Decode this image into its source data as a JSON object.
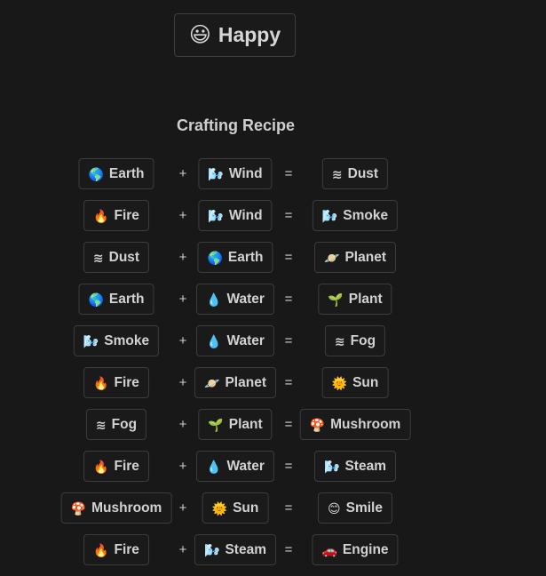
{
  "header": {
    "icon": "grinning-face-icon",
    "emoji": "😃",
    "label": "Happy"
  },
  "section_title": "Crafting Recipe",
  "operators": {
    "plus": "+",
    "equals": "="
  },
  "recipes": [
    {
      "a": {
        "emoji": "🌎",
        "icon": "earth-icon",
        "label": "Earth"
      },
      "b": {
        "emoji": "🌬️",
        "icon": "wind-icon",
        "label": "Wind"
      },
      "result": {
        "emoji": "≋",
        "icon": "dust-icon",
        "label": "Dust"
      }
    },
    {
      "a": {
        "emoji": "🔥",
        "icon": "fire-icon",
        "label": "Fire"
      },
      "b": {
        "emoji": "🌬️",
        "icon": "wind-icon",
        "label": "Wind"
      },
      "result": {
        "emoji": "🌬️",
        "icon": "smoke-icon",
        "label": "Smoke"
      }
    },
    {
      "a": {
        "emoji": "≋",
        "icon": "dust-icon",
        "label": "Dust"
      },
      "b": {
        "emoji": "🌎",
        "icon": "earth-icon",
        "label": "Earth"
      },
      "result": {
        "emoji": "🪐",
        "icon": "planet-icon",
        "label": "Planet"
      }
    },
    {
      "a": {
        "emoji": "🌎",
        "icon": "earth-icon",
        "label": "Earth"
      },
      "b": {
        "emoji": "💧",
        "icon": "water-icon",
        "label": "Water"
      },
      "result": {
        "emoji": "🌱",
        "icon": "plant-icon",
        "label": "Plant"
      }
    },
    {
      "a": {
        "emoji": "🌬️",
        "icon": "smoke-icon",
        "label": "Smoke"
      },
      "b": {
        "emoji": "💧",
        "icon": "water-icon",
        "label": "Water"
      },
      "result": {
        "emoji": "≋",
        "icon": "fog-icon",
        "label": "Fog"
      }
    },
    {
      "a": {
        "emoji": "🔥",
        "icon": "fire-icon",
        "label": "Fire"
      },
      "b": {
        "emoji": "🪐",
        "icon": "planet-icon",
        "label": "Planet"
      },
      "result": {
        "emoji": "🌞",
        "icon": "sun-icon",
        "label": "Sun"
      }
    },
    {
      "a": {
        "emoji": "≋",
        "icon": "fog-icon",
        "label": "Fog"
      },
      "b": {
        "emoji": "🌱",
        "icon": "plant-icon",
        "label": "Plant"
      },
      "result": {
        "emoji": "🍄",
        "icon": "mushroom-icon",
        "label": "Mushroom"
      }
    },
    {
      "a": {
        "emoji": "🔥",
        "icon": "fire-icon",
        "label": "Fire"
      },
      "b": {
        "emoji": "💧",
        "icon": "water-icon",
        "label": "Water"
      },
      "result": {
        "emoji": "🌬️",
        "icon": "steam-icon",
        "label": "Steam"
      }
    },
    {
      "a": {
        "emoji": "🍄",
        "icon": "mushroom-icon",
        "label": "Mushroom"
      },
      "b": {
        "emoji": "🌞",
        "icon": "sun-icon",
        "label": "Sun"
      },
      "result": {
        "emoji": "😊",
        "icon": "smile-icon",
        "label": "Smile"
      }
    },
    {
      "a": {
        "emoji": "🔥",
        "icon": "fire-icon",
        "label": "Fire"
      },
      "b": {
        "emoji": "🌬️",
        "icon": "steam-icon",
        "label": "Steam"
      },
      "result": {
        "emoji": "🚗",
        "icon": "car-icon",
        "label": "Engine"
      }
    }
  ]
}
